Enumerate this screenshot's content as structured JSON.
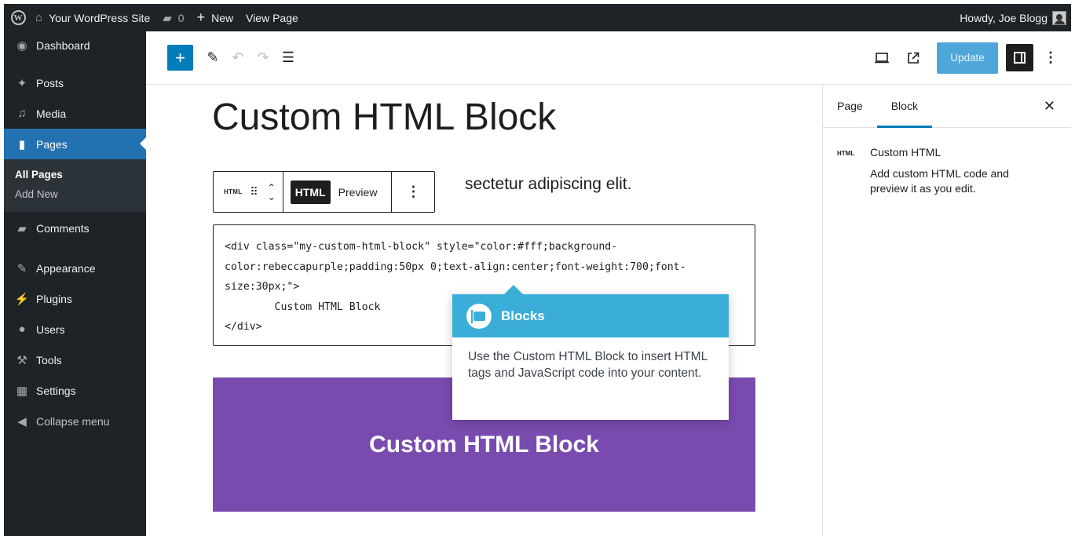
{
  "admin_bar": {
    "site_name": "Your WordPress Site",
    "comments_count": "0",
    "new_label": "New",
    "view_page_label": "View Page",
    "greeting": "Howdy, Joe Blogg"
  },
  "sidebar": {
    "items": [
      {
        "label": "Dashboard",
        "icon": "dashboard-icon"
      },
      {
        "label": "Posts",
        "icon": "pin-icon"
      },
      {
        "label": "Media",
        "icon": "media-icon"
      },
      {
        "label": "Pages",
        "icon": "pages-icon"
      },
      {
        "label": "Comments",
        "icon": "comment-icon"
      },
      {
        "label": "Appearance",
        "icon": "brush-icon"
      },
      {
        "label": "Plugins",
        "icon": "plug-icon"
      },
      {
        "label": "Users",
        "icon": "users-icon"
      },
      {
        "label": "Tools",
        "icon": "wrench-icon"
      },
      {
        "label": "Settings",
        "icon": "settings-icon"
      },
      {
        "label": "Collapse menu",
        "icon": "collapse-icon"
      }
    ],
    "submenu": [
      "All Pages",
      "Add New"
    ]
  },
  "toolbar": {
    "update_label": "Update"
  },
  "canvas": {
    "page_title": "Custom HTML Block",
    "paragraph_fragment": "sectetur adipiscing elit.",
    "block_type_label": "HTML",
    "tab_html": "HTML",
    "tab_preview": "Preview",
    "code": "<div class=\"my-custom-html-block\" style=\"color:#fff;background-\ncolor:rebeccapurple;padding:50px 0;text-align:center;font-weight:700;font-\nsize:30px;\">\n        Custom HTML Block\n</div>",
    "preview_text": "Custom HTML Block",
    "preview_color": "#7a4baf"
  },
  "pointer": {
    "title": "Blocks",
    "body": "Use the Custom HTML Block to insert HTML tags and JavaScript code into your content.",
    "color": "#3aaed8"
  },
  "inspector": {
    "tab_page": "Page",
    "tab_block": "Block",
    "block_icon_label": "HTML",
    "block_name": "Custom HTML",
    "block_description": "Add custom HTML code and preview it as you edit."
  }
}
